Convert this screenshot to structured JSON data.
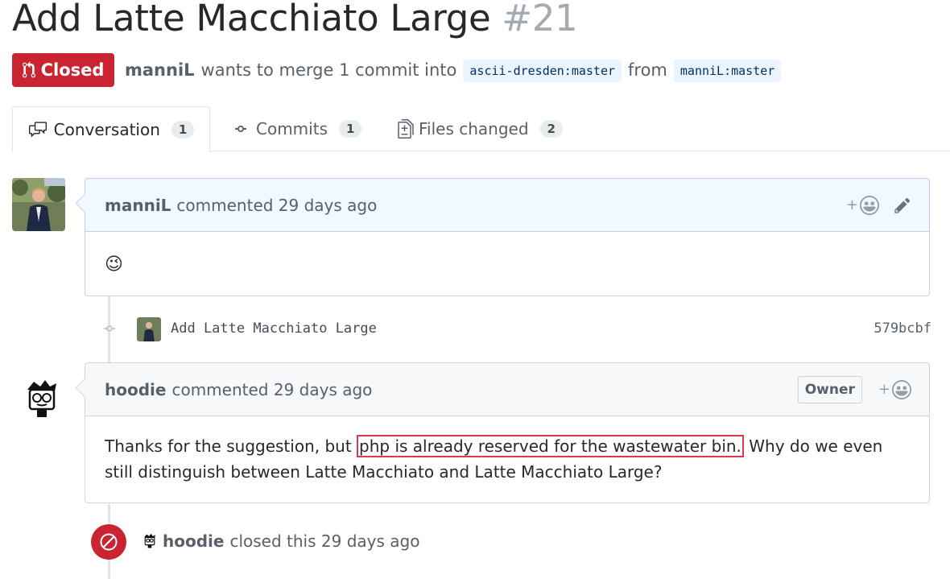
{
  "pr": {
    "title": "Add Latte Macchiato Large",
    "number": "#21",
    "state": "Closed",
    "author": "manniL",
    "action": "wants to merge 1 commit into",
    "base_ref": "ascii-dresden:master",
    "from_word": "from",
    "head_ref": "manniL:master"
  },
  "tabs": [
    {
      "label": "Conversation",
      "count": "1",
      "icon": "conversation-icon"
    },
    {
      "label": "Commits",
      "count": "1",
      "icon": "commit-icon"
    },
    {
      "label": "Files changed",
      "count": "2",
      "icon": "file-diff-icon"
    }
  ],
  "comments": [
    {
      "author": "manniL",
      "meta": "commented 29 days ago",
      "body": "😉"
    },
    {
      "author": "hoodie",
      "meta": "commented 29 days ago",
      "badge": "Owner",
      "body_before": "Thanks for the suggestion, but ",
      "body_highlight": "php is already reserved for the wastewater bin.",
      "body_after": " Why do we even still distinguish between Latte Macchiato and Latte Macchiato Large?"
    }
  ],
  "commit": {
    "message": "Add Latte Macchiato Large",
    "sha": "579bcbf"
  },
  "event": {
    "author": "hoodie",
    "text": "closed this 29 days ago"
  },
  "reaction_plus": "+",
  "colors": {
    "closed": "#cb2431",
    "ref_bg": "#eaf5ff",
    "highlight_border": "#d73a49"
  }
}
